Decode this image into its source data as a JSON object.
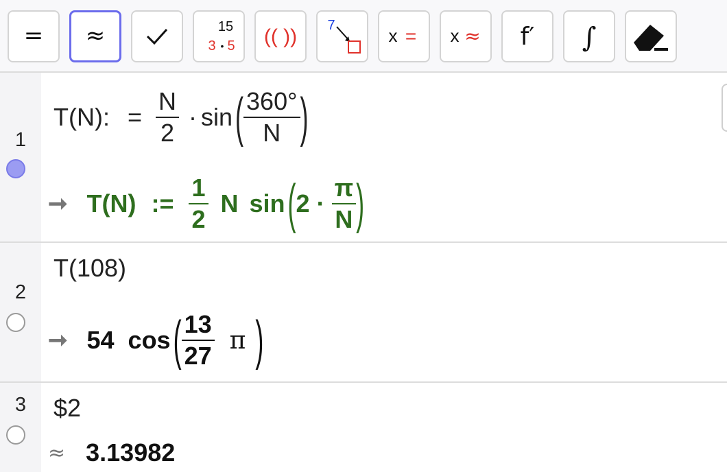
{
  "toolbar": {
    "buttons": [
      {
        "id": "evaluate",
        "symbol": "="
      },
      {
        "id": "numeric",
        "symbol": "≈",
        "selected": true
      },
      {
        "id": "check",
        "symbol": "✓"
      },
      {
        "id": "factor",
        "top": "15",
        "bottom_a": "3",
        "dot": "•",
        "bottom_b": "5"
      },
      {
        "id": "expand",
        "symbol": "(( ))"
      },
      {
        "id": "substitute",
        "digit": "7"
      },
      {
        "id": "solve",
        "x": "x",
        "op": "="
      },
      {
        "id": "nsolve",
        "x": "x",
        "op": "≈"
      },
      {
        "id": "derivative",
        "symbol": "f′"
      },
      {
        "id": "integral",
        "symbol": "∫"
      },
      {
        "id": "delete"
      }
    ]
  },
  "cells": [
    {
      "number": "1",
      "visible": true,
      "input": {
        "lhs": "T(N):",
        "assign": "=",
        "frac_num": "N",
        "frac_den": "2",
        "dot": "·",
        "func": "sin",
        "arg_num": "360°",
        "arg_den": "N"
      },
      "output": {
        "arrow": "➞",
        "lhs": "T(N)",
        "assign": ":=",
        "frac_num": "1",
        "frac_den": "2",
        "var": "N",
        "func": "sin",
        "inner_coef": "2",
        "dot": "·",
        "pi_num": "π",
        "pi_den": "N"
      }
    },
    {
      "number": "2",
      "visible": false,
      "input": {
        "text": "T(108)"
      },
      "output": {
        "arrow": "➞",
        "coef": "54",
        "func": "cos",
        "frac_num": "13",
        "frac_den": "27",
        "pi": "π"
      }
    },
    {
      "number": "3",
      "visible": false,
      "input": {
        "text": "$2"
      },
      "output": {
        "symbol": "≈",
        "value": "3.13982"
      }
    }
  ],
  "colors": {
    "accent": "#6b6cec",
    "green_output": "#2e6e1e",
    "red_symbol": "#e0322b"
  }
}
